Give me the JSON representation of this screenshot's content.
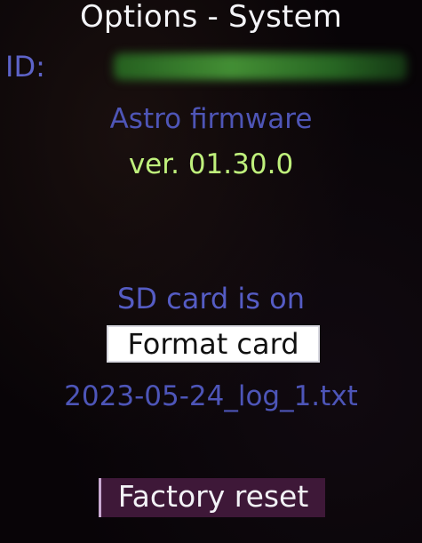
{
  "screen": {
    "title": "Options - System"
  },
  "device": {
    "id_label": "ID:",
    "id_value": ""
  },
  "firmware": {
    "label": "Astro firmware",
    "version": "ver. 01.30.0"
  },
  "sd_card": {
    "status": "SD card is on",
    "format_button_label": "Format card",
    "log_file": "2023-05-24_log_1.txt"
  },
  "actions": {
    "factory_reset_label": "Factory reset"
  },
  "colors": {
    "background": "#080407",
    "title": "#f4f4f8",
    "label_blue": "#555cc4",
    "version_green": "#bff07c",
    "id_value_green": "#46963a",
    "format_button_bg": "#ffffff",
    "reset_button_bg": "#3e1838"
  }
}
